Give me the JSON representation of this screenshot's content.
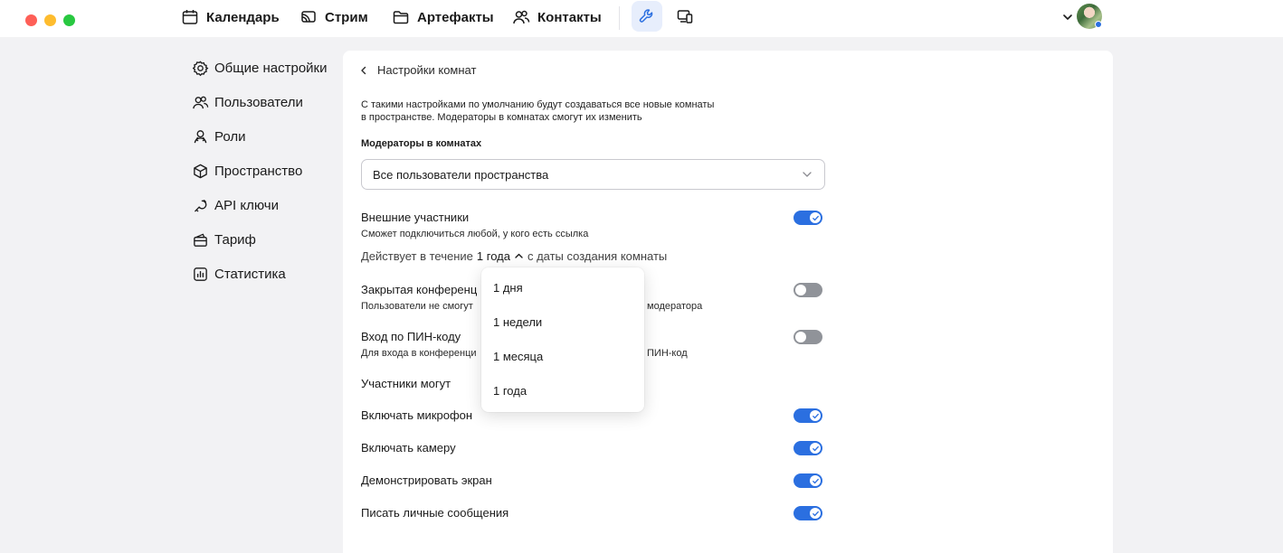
{
  "window": {
    "traffic_lights": [
      "close",
      "minimize",
      "zoom"
    ]
  },
  "nav": {
    "items": [
      {
        "label": "Календарь",
        "icon": "calendar-icon"
      },
      {
        "label": "Стрим",
        "icon": "stream-icon"
      },
      {
        "label": "Артефакты",
        "icon": "folder-icon"
      },
      {
        "label": "Контакты",
        "icon": "contacts-icon"
      }
    ],
    "tools": [
      {
        "icon": "wrench-icon",
        "active": true
      },
      {
        "icon": "devices-icon",
        "active": false
      }
    ]
  },
  "account": {
    "chevron_icon": "chevron-down-icon",
    "status_color": "#2b6fe0"
  },
  "sidebar": {
    "items": [
      {
        "label": "Общие настройки",
        "icon": "gear-icon"
      },
      {
        "label": "Пользователи",
        "icon": "users-icon"
      },
      {
        "label": "Роли",
        "icon": "roles-icon"
      },
      {
        "label": "Пространство",
        "icon": "cube-icon"
      },
      {
        "label": "API ключи",
        "icon": "api-key-icon"
      },
      {
        "label": "Тариф",
        "icon": "tariff-icon"
      },
      {
        "label": "Статистика",
        "icon": "stats-icon"
      }
    ]
  },
  "settings": {
    "back_label": "Настройки комнат",
    "description_line1": "С такими настройками по умолчанию будут создаваться все новые комнаты",
    "description_line2": "в пространстве. Модераторы в комнатах смогут их изменить",
    "moderators_label": "Модераторы в комнатах",
    "moderators_value": "Все пользователи пространства",
    "external": {
      "title": "Внешние участники",
      "subtitle": "Сможет подключиться любой, у кого есть ссылка",
      "enabled": true,
      "duration_prefix": "Действует в течение",
      "duration_value": "1 года",
      "duration_suffix": "с даты создания комнаты"
    },
    "closed": {
      "title_visible": "Закрытая конференц",
      "subtitle_visible_start": "Пользователи не смогут",
      "subtitle_visible_end": "модератора",
      "enabled": false
    },
    "pin": {
      "title": "Вход по ПИН-коду",
      "subtitle_visible_start": "Для входа в конференци",
      "subtitle_visible_end": "ПИН-код",
      "enabled": false
    },
    "participants_heading": "Участники могут",
    "permissions": [
      {
        "label": "Включать микрофон",
        "enabled": true
      },
      {
        "label": "Включать камеру",
        "enabled": true
      },
      {
        "label": "Демонстрировать экран",
        "enabled": true
      },
      {
        "label": "Писать личные сообщения",
        "enabled": true
      }
    ]
  },
  "duration_menu": {
    "options": [
      "1 дня",
      "1 недели",
      "1 месяца",
      "1 года"
    ],
    "selected": "1 года"
  },
  "colors": {
    "accent": "#2b6fe0",
    "toggle_off": "#909399",
    "page_bg": "#f2f2f4"
  }
}
